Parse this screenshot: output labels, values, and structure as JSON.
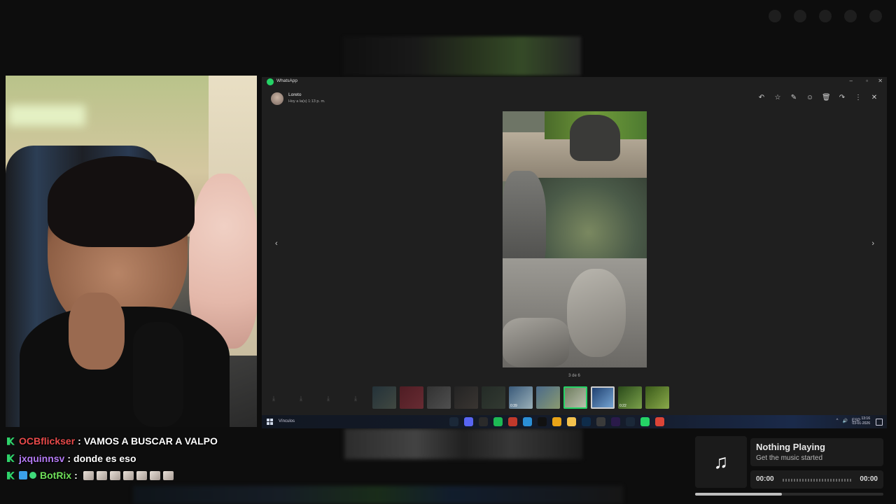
{
  "background": {
    "top_left_title": "",
    "top_left_subtitle": ""
  },
  "chat": {
    "messages": [
      {
        "user": "OCBflickser",
        "user_color": "#e84a4a",
        "text": "VAMOS A BUSCAR A VALPO"
      },
      {
        "user": "jxquinnsv",
        "user_color": "#b57bf5",
        "text": "donde es eso"
      },
      {
        "user": "BotRix",
        "user_color": "#6fe05a",
        "text": ""
      }
    ],
    "separator": ":"
  },
  "whatsapp": {
    "window_title": "WhatsApp",
    "window_buttons": {
      "minimize": "–",
      "maximize": "▫",
      "close": "✕"
    },
    "contact_name": "Loreto",
    "timestamp": "Hoy a la(s) 1:13 p. m.",
    "toolbar_icons": [
      "reply-icon",
      "star-icon",
      "pin-icon",
      "emoji-icon",
      "delete-icon",
      "forward-icon",
      "more-icon",
      "close-icon"
    ],
    "toolbar_glyphs": [
      "↶",
      "☆",
      "✎",
      "☺",
      "🗑",
      "↷",
      "⋮",
      "✕"
    ],
    "counter": "3 de 6",
    "prev_arrow": "‹",
    "next_arrow": "›",
    "download_glyph": "⤓",
    "thumbnails": [
      {
        "name": "thumb-1",
        "bg": "linear-gradient(135deg,#2a4a5a,#6a7a6a)",
        "duration": "",
        "state": "dim"
      },
      {
        "name": "thumb-2",
        "bg": "linear-gradient(135deg,#8a1a2a,#c03a4a)",
        "duration": "",
        "state": "dim"
      },
      {
        "name": "thumb-3",
        "bg": "linear-gradient(135deg,#4a4a4a,#8a8a8a)",
        "duration": "",
        "state": "dim"
      },
      {
        "name": "thumb-4",
        "bg": "linear-gradient(135deg,#2a2a2a,#5a5048)",
        "duration": "",
        "state": "dim"
      },
      {
        "name": "thumb-5",
        "bg": "linear-gradient(135deg,#2a3a30,#4a5a48)",
        "duration": "",
        "state": "dim"
      },
      {
        "name": "thumb-6",
        "bg": "linear-gradient(135deg,#3a5a7a,#9ab0b8)",
        "duration": "0:39",
        "state": "normal"
      },
      {
        "name": "thumb-7",
        "bg": "linear-gradient(135deg,#4a6a8a,#8a9a70)",
        "duration": "",
        "state": "normal"
      },
      {
        "name": "thumb-8",
        "bg": "linear-gradient(135deg,#6a7a5a,#c0c4b4)",
        "duration": "",
        "state": "selected"
      },
      {
        "name": "thumb-9",
        "bg": "linear-gradient(135deg,#1a3a6a,#7aaad8)",
        "duration": "",
        "state": "hover"
      },
      {
        "name": "thumb-10",
        "bg": "linear-gradient(135deg,#2a4a1a,#7aa04a)",
        "duration": "0:22",
        "state": "normal"
      },
      {
        "name": "thumb-11",
        "bg": "linear-gradient(135deg,#3a5a1a,#8aaa4a)",
        "duration": "",
        "state": "normal"
      }
    ]
  },
  "taskbar": {
    "links_label": "Vínculos",
    "apps": [
      {
        "name": "steam-app",
        "color": "#1b2838"
      },
      {
        "name": "discord-app",
        "color": "#5865f2"
      },
      {
        "name": "obs-app",
        "color": "#2a2a2a"
      },
      {
        "name": "spotify-app",
        "color": "#1db954"
      },
      {
        "name": "recorder-app",
        "color": "#c0392b"
      },
      {
        "name": "edge-app",
        "color": "#2b8fd6"
      },
      {
        "name": "tidal-app",
        "color": "#111111"
      },
      {
        "name": "chrome-app",
        "color": "#e8a317"
      },
      {
        "name": "explorer-app",
        "color": "#f2c14e"
      },
      {
        "name": "photoshop-app",
        "color": "#0f2c4a"
      },
      {
        "name": "calculator-app",
        "color": "#3a3a3a"
      },
      {
        "name": "premiere-app",
        "color": "#2a1a4a"
      },
      {
        "name": "steam2-app",
        "color": "#1b2838"
      },
      {
        "name": "whatsapp-app",
        "color": "#25d366"
      },
      {
        "name": "chrome2-app",
        "color": "#db4437"
      }
    ],
    "tray_chevron": "^",
    "tray_sound": "🔊",
    "language": "ESP",
    "time": "13:16",
    "date": "03-01-2026"
  },
  "music": {
    "title": "Nothing Playing",
    "subtitle": "Get the music started",
    "current_time": "00:00",
    "total_time": "00:00",
    "note_glyph": "♫",
    "progress": 0.46
  }
}
